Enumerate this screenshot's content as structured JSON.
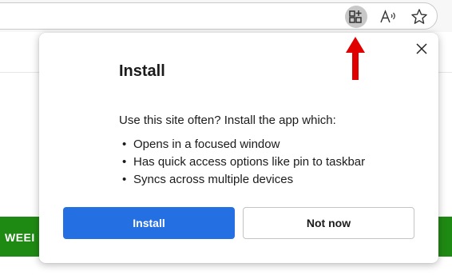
{
  "toolbar": {
    "icons": [
      "app-install-icon",
      "read-aloud-icon",
      "favorites-star-icon"
    ]
  },
  "background": {
    "banner_text": "WEEI",
    "banner_color": "#1f8a13"
  },
  "flyout": {
    "title": "Install",
    "description": "Use this site often? Install the app which:",
    "bullets": [
      "Opens in a focused window",
      "Has quick access options like pin to taskbar",
      "Syncs across multiple devices"
    ],
    "install_label": "Install",
    "not_now_label": "Not now",
    "accent_color": "#2470e3"
  },
  "annotation": {
    "arrow_color": "#e00000"
  }
}
